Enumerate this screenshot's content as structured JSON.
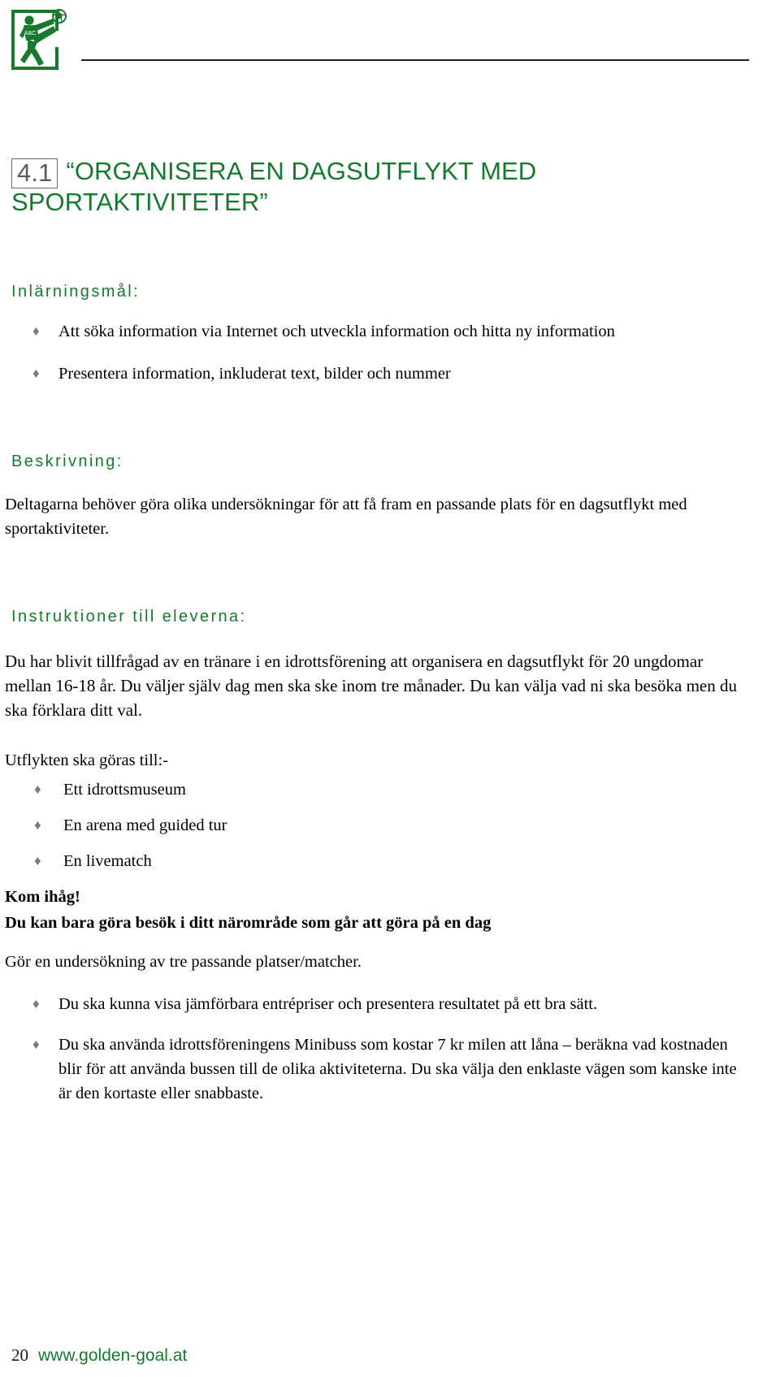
{
  "header": {
    "logo_alt": "golden-goal-logo",
    "logo_shirt_text": "ABC",
    "logo_color": "#17792e"
  },
  "title": {
    "number": "4.1",
    "line1": "“ORGANISERA EN DAGSUTFLYKT MED",
    "line2": "SPORTAKTIVITETER”"
  },
  "colors": {
    "green": "#17792e",
    "bullet_gray": "#7a7a7a",
    "number_gray": "#5a5a5a"
  },
  "learning": {
    "heading": "Inlärningsmål:",
    "items": [
      "Att söka information via Internet och utveckla information och hitta ny information",
      "Presentera information, inkluderat text, bilder och nummer"
    ]
  },
  "description": {
    "heading": "Beskrivning:",
    "text": "Deltagarna behöver göra olika undersökningar för att få fram en passande plats för en dagsutflykt med sportaktiviteter."
  },
  "instructions": {
    "heading": "Instruktioner till eleverna:",
    "intro": "Du har blivit tillfrågad av en tränare i en idrottsförening att organisera en dagsutflykt för 20 ungdomar mellan 16-18 år. Du väljer själv dag men ska ske inom tre månader. Du kan välja vad ni ska besöka men du ska förklara ditt val.",
    "trip_intro": "Utflykten ska göras till:-",
    "places": [
      "Ett idrottsmuseum",
      "En arena med guided tur",
      "En livematch"
    ],
    "remember_label": "Kom ihåg!",
    "remember_text": "Du kan bara göra besök i ditt närområde som går att göra på en dag",
    "research_text": "Gör en undersökning av tre passande platser/matcher.",
    "tasks": [
      "Du ska kunna visa jämförbara entrépriser och presentera resultatet på ett bra sätt.",
      "Du ska använda idrottsföreningens Minibuss som kostar 7 kr milen att låna – beräkna vad kostnaden blir för att använda bussen till de olika aktiviteterna. Du ska välja den enklaste vägen som kanske inte är den kortaste eller snabbaste."
    ]
  },
  "footer": {
    "page_number": "20",
    "url": "www.golden-goal.at"
  }
}
